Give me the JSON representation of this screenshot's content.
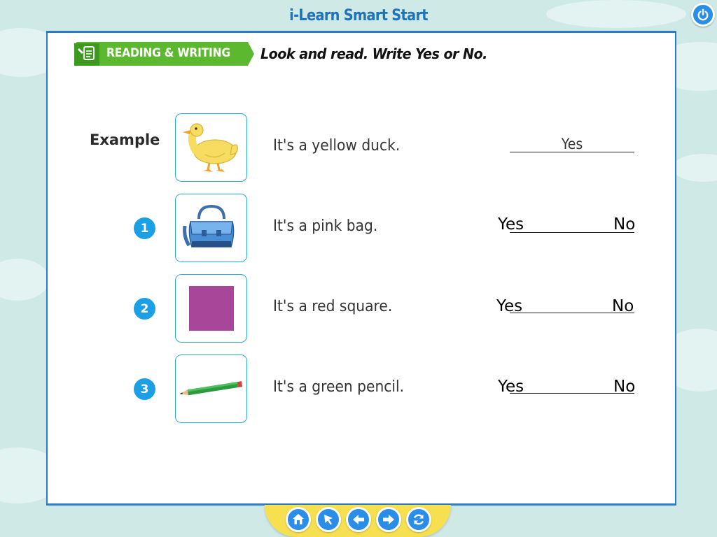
{
  "app": {
    "title": "i-Learn Smart Start"
  },
  "toolbar": {
    "power_icon": "power-icon"
  },
  "section": {
    "badge_label": "READING & WRITING",
    "badge_icon": "pencil-paper-icon",
    "instruction": "Look and read. Write Yes or No."
  },
  "example": {
    "label": "Example",
    "picture": "duck",
    "sentence": "It's a yellow duck.",
    "answer": "Yes"
  },
  "questions": [
    {
      "number": "1",
      "picture": "bag",
      "sentence": "It's a pink bag.",
      "yes": "Yes",
      "no": "No"
    },
    {
      "number": "2",
      "picture": "square",
      "sentence": "It's a red square.",
      "yes": "Yes",
      "no": "No"
    },
    {
      "number": "3",
      "picture": "pencil",
      "sentence": "It's a green pencil.",
      "yes": "Yes",
      "no": "No"
    }
  ],
  "bottom_nav": [
    "home-icon",
    "pointer-icon",
    "back-arrow-icon",
    "forward-arrow-icon",
    "refresh-icon"
  ],
  "colors": {
    "background": "#cfe9e6",
    "title": "#1f73b8",
    "badge_green": "#5cb82e",
    "number_blue": "#1ba0e6",
    "square": "#a8479a",
    "nav_bar": "#f6e04f"
  }
}
